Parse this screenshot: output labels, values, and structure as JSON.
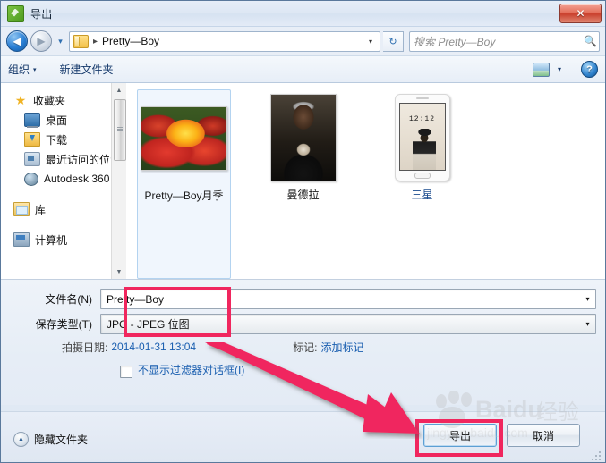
{
  "window": {
    "title": "导出",
    "app_icon": "export-icon",
    "close_label": "✕"
  },
  "navbar": {
    "back_icon": "back-arrow-icon",
    "forward_icon": "forward-arrow-icon",
    "history_caret": "▾",
    "folder_icon": "folder-icon",
    "breadcrumb_sep": "▸",
    "breadcrumb": "Pretty—Boy",
    "address_caret": "▾",
    "refresh_icon": "↻",
    "search_placeholder": "搜索 Pretty—Boy",
    "search_icon": "search-icon"
  },
  "toolbar": {
    "organize_label": "组织",
    "organize_caret": "▾",
    "new_folder_label": "新建文件夹",
    "view_icon": "view-mode-icon",
    "view_caret": "▾",
    "help_label": "?"
  },
  "sidebar": {
    "groups": [
      {
        "header": {
          "label": "收藏夹",
          "icon": "star-icon"
        },
        "items": [
          {
            "label": "桌面",
            "icon": "desktop-icon"
          },
          {
            "label": "下载",
            "icon": "download-icon"
          },
          {
            "label": "最近访问的位置",
            "icon": "recent-places-icon"
          },
          {
            "label": "Autodesk 360",
            "icon": "cloud-icon"
          }
        ]
      },
      {
        "header": {
          "label": "库",
          "icon": "library-icon"
        },
        "items": []
      },
      {
        "header": {
          "label": "计算机",
          "icon": "computer-icon"
        },
        "items": []
      }
    ],
    "scroll_up": "▲",
    "scroll_down": "▼"
  },
  "files": [
    {
      "label": "Pretty—Boy月季",
      "thumb": "rose-photo",
      "selected": true
    },
    {
      "label": "曼德拉",
      "thumb": "mandela-portrait",
      "selected": false
    },
    {
      "label": "三星",
      "thumb": "samsung-phone",
      "selected": false
    }
  ],
  "phone_thumb": {
    "time": "12:12"
  },
  "form": {
    "filename_label": "文件名(N)",
    "filename_value": "Pretty—Boy",
    "filetype_label": "保存类型(T)",
    "filetype_value": "JPG - JPEG 位图",
    "dropdown_caret": "▾",
    "date_label": "拍摄日期:",
    "date_value": "2014-01-31 13:04",
    "tags_label": "标记:",
    "tags_value": "添加标记"
  },
  "options": {
    "filter_checkbox_label": "不显示过滤器对话框(I)",
    "checked": false
  },
  "footer": {
    "hide_folders_label": "隐藏文件夹",
    "hide_folders_icon": "chevron-up-icon",
    "export_label": "导出",
    "cancel_label": "取消"
  },
  "annotations": {
    "color": "#f0265e",
    "boxes": [
      "filename-and-type-fields",
      "export-button"
    ],
    "arrow": "arrow-from-fields-to-export-button"
  },
  "watermark": {
    "brand": "Baidu",
    "suffix": "经验",
    "url": "jingyan.baidu.com"
  }
}
